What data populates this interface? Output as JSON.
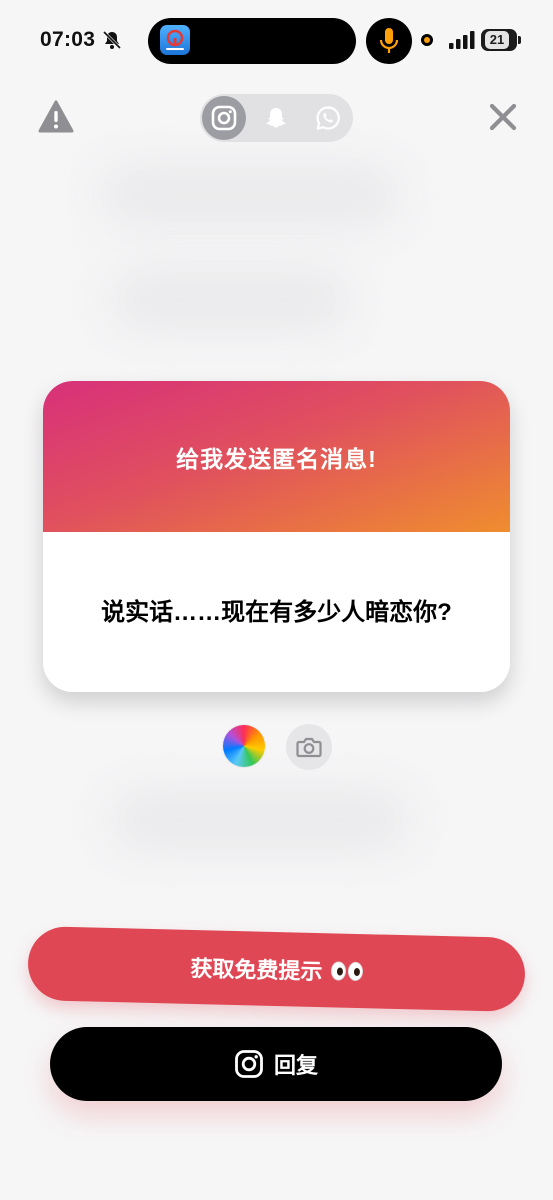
{
  "status_bar": {
    "time": "07:03",
    "battery_level": "21",
    "app_icon": "train-app-icon",
    "mic_color": "#ff9f0a"
  },
  "top_bar": {
    "warning_icon": "warning-triangle-icon",
    "platforms": [
      {
        "icon": "instagram-icon",
        "active": true
      },
      {
        "icon": "snapchat-icon",
        "active": false
      },
      {
        "icon": "whatsapp-icon",
        "active": false
      }
    ],
    "close_icon": "close-x-icon"
  },
  "card": {
    "title": "给我发送匿名消息!",
    "question": "说实话……现在有多少人暗恋你?",
    "gradient": [
      "#d8307a",
      "#e0505e",
      "#ef8d2f"
    ]
  },
  "options": {
    "color_icon": "color-wheel-icon",
    "camera_icon": "camera-icon"
  },
  "buttons": {
    "hint_label": "获取免费提示",
    "hint_emoji": "eyes-emoji",
    "hint_color": "#e04754",
    "reply_label": "回复",
    "reply_icon": "instagram-icon"
  }
}
